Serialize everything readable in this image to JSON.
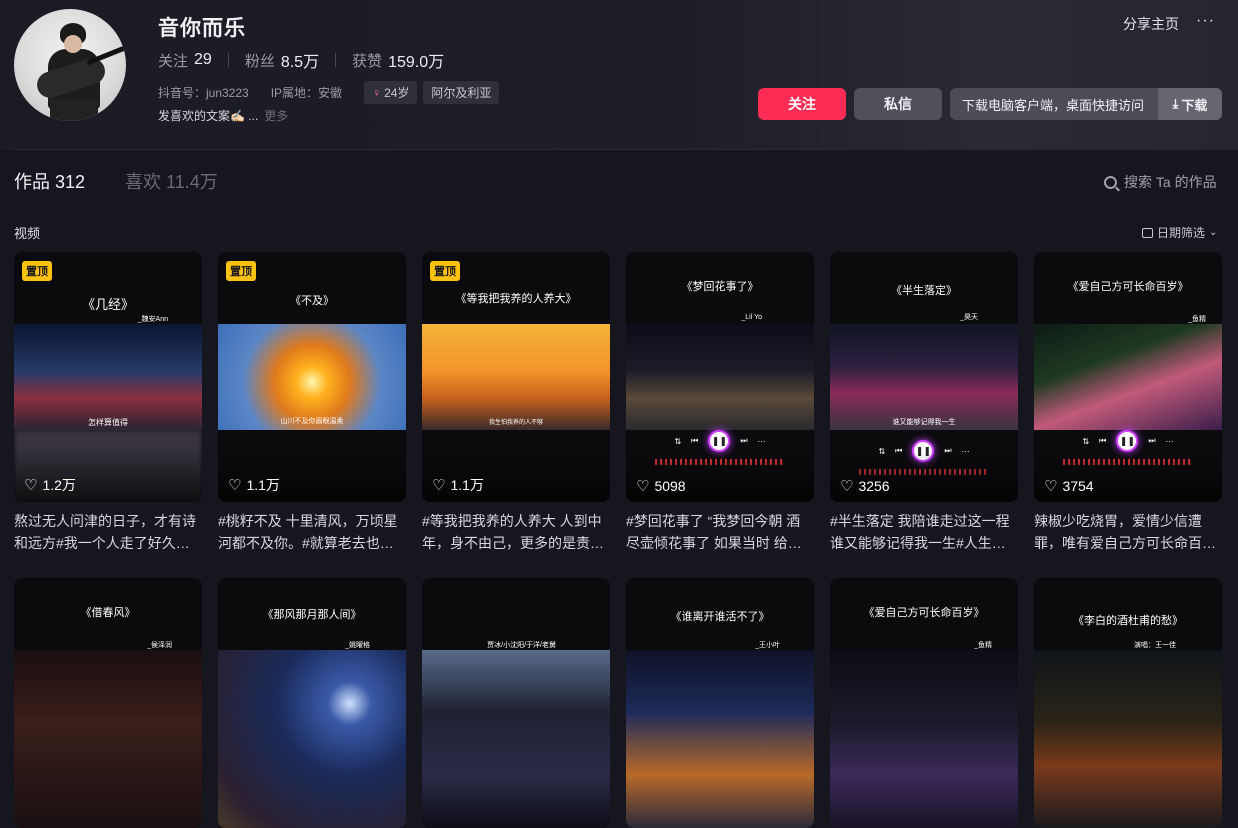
{
  "profile": {
    "name": "音你而乐",
    "following_label": "关注",
    "following": "29",
    "followers_label": "粉丝",
    "followers": "8.5万",
    "likes_label": "获赞",
    "likes": "159.0万",
    "douyin_id": "抖音号：jun3223",
    "ip": "IP属地：安徽",
    "age_tag": "24岁",
    "location_tag": "阿尔及利亚",
    "bio": "发喜欢的文案✍🏻 ...",
    "bio_more": "更多"
  },
  "header_actions": {
    "share": "分享主页",
    "more": "···",
    "follow": "关注",
    "message": "私信",
    "client_text": "下载电脑客户端，桌面快捷访问",
    "download": "下载"
  },
  "tabs": {
    "works": "作品 312",
    "liked": "喜欢 11.4万",
    "search": "搜索 Ta 的作品",
    "section": "视频",
    "date_filter": "日期筛选"
  },
  "pin_label": "置顶",
  "videos": [
    {
      "title": "《几经》",
      "singer": "_魏安Ann",
      "likes": "1.2万",
      "pinned": true,
      "caption_line": "怎样算值得",
      "desc": "熬过无人问津的日子，才有诗和远方#我一个人走了好久…"
    },
    {
      "title": "《不及》",
      "singer": "",
      "likes": "1.1万",
      "pinned": true,
      "caption_line": "山川不及你眉眼温柔",
      "desc": "#桃籽不及 十里清风，万顷星河都不及你。#就算老去也…"
    },
    {
      "title": "《等我把我养的人养大》",
      "singer": "",
      "likes": "1.1万",
      "pinned": true,
      "caption_line": "我生怕我养的人不够",
      "desc": "#等我把我养的人养大 人到中年，身不由己，更多的是责…"
    },
    {
      "title": "《梦回花事了》",
      "singer": "_Lil Yo",
      "likes": "5098",
      "pinned": false,
      "caption_line": "",
      "desc": "#梦回花事了 “我梦回今朝 酒尽壶倾花事了 如果当时 给…"
    },
    {
      "title": "《半生落定》",
      "singer": "_昊天",
      "likes": "3256",
      "pinned": false,
      "caption_line": "谁又能够记得我一生",
      "desc": "#半生落定 我陪谁走过这一程 谁又能够记得我一生#人生…"
    },
    {
      "title": "《爱自己方可长命百岁》",
      "singer": "_鱼精",
      "likes": "3754",
      "pinned": false,
      "caption_line": "",
      "desc": "辣椒少吃烧胃，爱情少信遭罪，唯有爱自己方可长命百…"
    },
    {
      "title": "《借春风》",
      "singer": "_侯泽润",
      "likes": "",
      "pinned": false,
      "caption_line": "",
      "desc": ""
    },
    {
      "title": "《那风那月那人间》",
      "singer": "_姚曜格",
      "likes": "",
      "pinned": false,
      "caption_line": "",
      "desc": ""
    },
    {
      "title": "",
      "singer": "贾冰/小沈阳/于洋/老舅",
      "likes": "",
      "pinned": false,
      "caption_line": "",
      "desc": ""
    },
    {
      "title": "《谁离开谁活不了》",
      "singer": "_王小叶",
      "likes": "",
      "pinned": false,
      "caption_line": "",
      "desc": ""
    },
    {
      "title": "《爱自己方可长命百岁》",
      "singer": "_鱼精",
      "likes": "",
      "pinned": false,
      "caption_line": "",
      "desc": ""
    },
    {
      "title": "《李白的酒杜甫的愁》",
      "singer": "演唱：王一佳",
      "likes": "",
      "pinned": false,
      "caption_line": "",
      "desc": ""
    }
  ],
  "icons": {
    "heart": "heart-icon",
    "search": "search-icon",
    "calendar": "calendar-icon",
    "download": "download-icon",
    "female": "female-icon"
  },
  "colors": {
    "follow": "#fe2c55",
    "pin": "#ffc20e",
    "background": "#16161e"
  }
}
